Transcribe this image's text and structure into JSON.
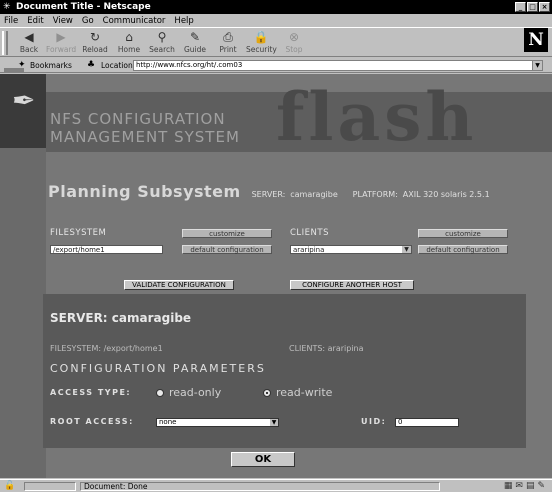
{
  "window": {
    "title": "Document Title - Netscape",
    "min": "_",
    "max": "□",
    "close": "×"
  },
  "menu": [
    "File",
    "Edit",
    "View",
    "Go",
    "Communicator",
    "Help"
  ],
  "toolbar": {
    "buttons": [
      {
        "label": "Back",
        "icon": "back-arrow-icon",
        "glyph": "◀"
      },
      {
        "label": "Forward",
        "icon": "forward-arrow-icon",
        "glyph": "▶"
      },
      {
        "label": "Reload",
        "icon": "reload-icon",
        "glyph": "↻"
      },
      {
        "label": "Home",
        "icon": "home-icon",
        "glyph": "⌂"
      },
      {
        "label": "Search",
        "icon": "search-icon",
        "glyph": "⚲"
      },
      {
        "label": "Guide",
        "icon": "guide-icon",
        "glyph": "✎"
      },
      {
        "label": "Print",
        "icon": "print-icon",
        "glyph": "⎙"
      },
      {
        "label": "Security",
        "icon": "lock-icon",
        "glyph": "🔒"
      },
      {
        "label": "Stop",
        "icon": "stop-icon",
        "glyph": "⊗"
      }
    ],
    "brand": "N"
  },
  "location": {
    "bookmarks": "Bookmarks",
    "label": "Location:",
    "url": "http://www.nfcs.org/ht/.com03"
  },
  "banner": {
    "line1": "NFS CONFIGURATION",
    "line2": "MANAGEMENT SYSTEM",
    "watermark": "flash"
  },
  "subsystem": {
    "title": "Planning Subsystem",
    "server_label": "SERVER:",
    "server": "camaragibe",
    "platform_label": "PLATFORM:",
    "platform": "AXIL 320 solaris 2.5.1"
  },
  "filesystem": {
    "label": "FILESYSTEM",
    "customize": "customize",
    "value": "/export/home1",
    "default_config": "default configuration"
  },
  "clients": {
    "label": "CLIENTS",
    "customize": "customize",
    "value": "araripina",
    "default_config": "default configuration"
  },
  "actions": {
    "validate": "VALIDATE CONFIGURATION",
    "configure_another": "CONFIGURE    ANOTHER HOST"
  },
  "panel": {
    "server_heading": "SERVER: camaragibe",
    "filesystem_line": "FILESYSTEM: /export/home1",
    "clients_line": "CLIENTS: araripina",
    "config_params": "CONFIGURATION PARAMETERS",
    "access_type_label": "ACCESS TYPE:",
    "read_only": "read-only",
    "read_write": "read-write",
    "root_access_label": "ROOT ACCESS:",
    "root_access_value": "none",
    "uid_label": "UID:",
    "uid_value": "0"
  },
  "ok": "OK",
  "status": {
    "message": "Document: Done"
  }
}
